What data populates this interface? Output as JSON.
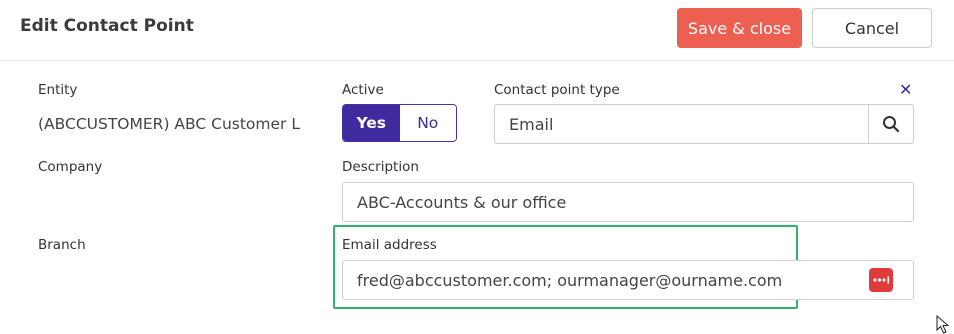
{
  "dialog": {
    "title": "Edit Contact Point",
    "save_label": "Save & close",
    "cancel_label": "Cancel"
  },
  "form": {
    "entity": {
      "label": "Entity",
      "value": "(ABCCUSTOMER) ABC Customer L"
    },
    "active": {
      "label": "Active",
      "yes_label": "Yes",
      "no_label": "No",
      "selected": "Yes"
    },
    "contact_point_type": {
      "label": "Contact point type",
      "value": "Email"
    },
    "company": {
      "label": "Company"
    },
    "description": {
      "label": "Description",
      "value": "ABC-Accounts & our office"
    },
    "branch": {
      "label": "Branch"
    },
    "email_address": {
      "label": "Email address",
      "value": "fred@abccustomer.com; ourmanager@ourname.com"
    }
  },
  "colors": {
    "save_button": "#ec5f51",
    "active_toggle": "#3f2a9e",
    "highlight_box": "#2fb56a",
    "password_icon": "#e03a3a"
  },
  "icons": [
    "clear-icon",
    "search-icon",
    "password-manager-icon",
    "mouse-cursor-icon"
  ]
}
